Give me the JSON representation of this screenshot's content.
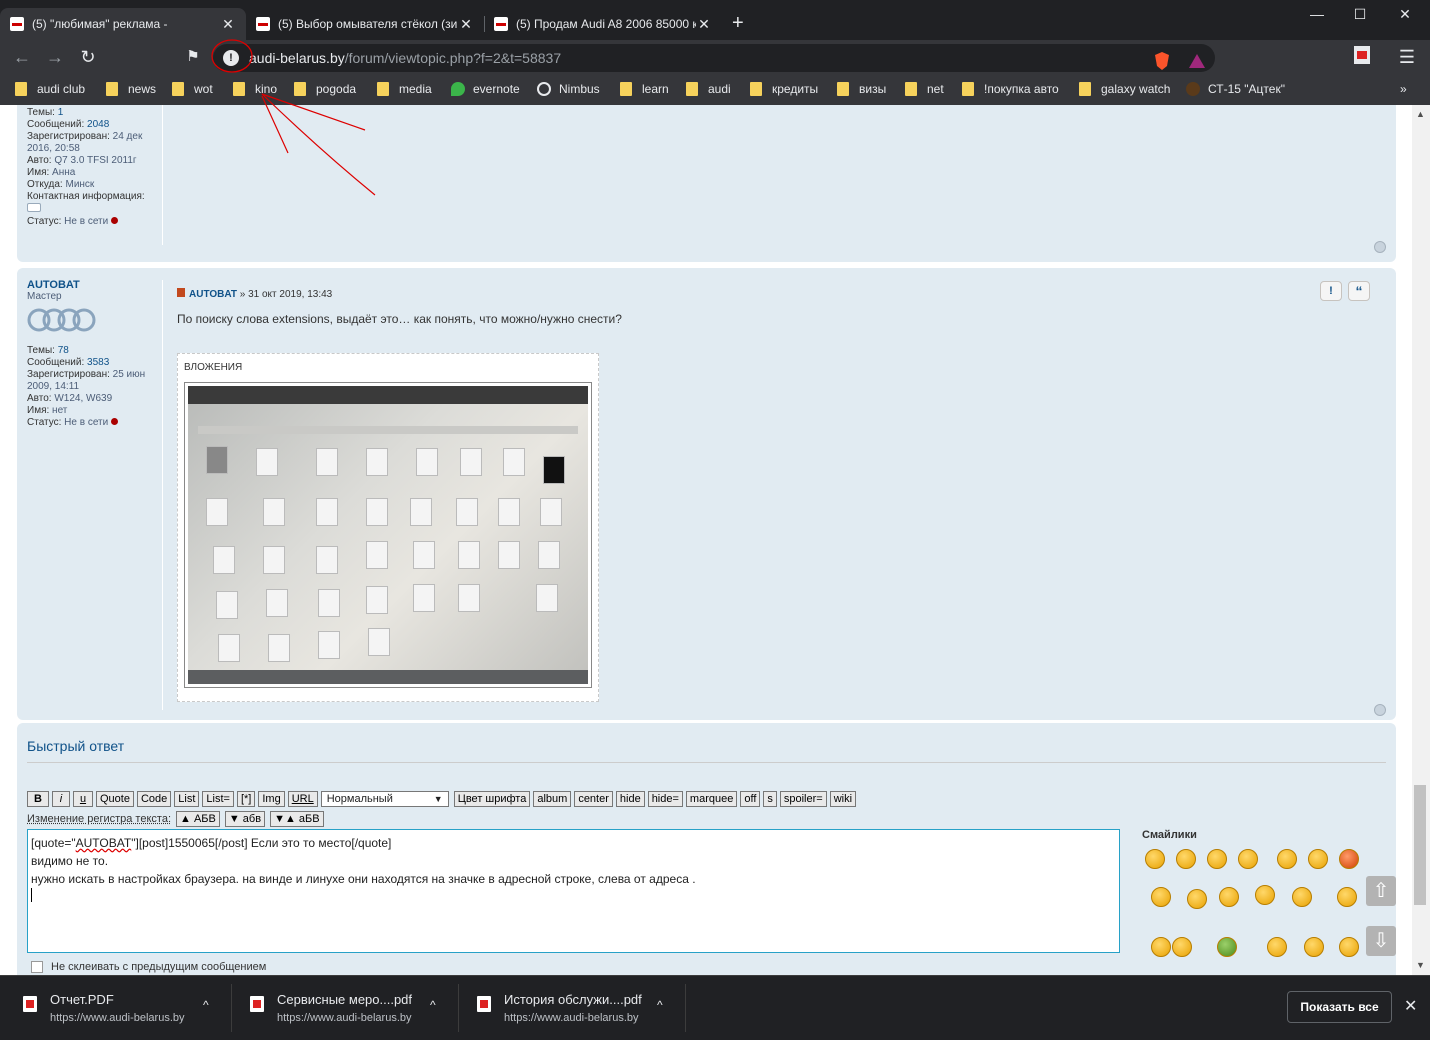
{
  "tabs": [
    {
      "title": "(5) \"любимая\" реклама -",
      "active": true
    },
    {
      "title": "(5) Выбор омывателя стёкол (зим",
      "active": false
    },
    {
      "title": "(5) Продам Audi A8 2006 85000 км",
      "active": false
    }
  ],
  "address": {
    "domain": "audi-belarus.by",
    "path": "/forum/viewtopic.php?f=2&t=58837"
  },
  "bookmarks": [
    {
      "label": "audi club",
      "icon": "folder-icon"
    },
    {
      "label": "news",
      "icon": "folder-icon"
    },
    {
      "label": "wot",
      "icon": "folder-icon"
    },
    {
      "label": "kino",
      "icon": "folder-icon"
    },
    {
      "label": "pogoda",
      "icon": "folder-icon"
    },
    {
      "label": "media",
      "icon": "folder-icon"
    },
    {
      "label": "evernote",
      "icon": "evernote-icon"
    },
    {
      "label": "Nimbus",
      "icon": "globe-icon"
    },
    {
      "label": "learn",
      "icon": "folder-icon"
    },
    {
      "label": "audi",
      "icon": "folder-icon"
    },
    {
      "label": "кредиты",
      "icon": "folder-icon"
    },
    {
      "label": "визы",
      "icon": "folder-icon"
    },
    {
      "label": "net",
      "icon": "folder-icon"
    },
    {
      "label": "!покупка авто",
      "icon": "folder-icon"
    },
    {
      "label": "galaxy watch",
      "icon": "folder-icon"
    },
    {
      "label": "СТ-15 \"Ацтек\"",
      "icon": "site-icon"
    }
  ],
  "post1": {
    "topics_label": "Темы:",
    "topics": "1",
    "messages_label": "Сообщений:",
    "messages": "2048",
    "registered_label": "Зарегистрирован:",
    "registered": "24 дек 2016, 20:58",
    "auto_label": "Авто:",
    "auto": "Q7 3.0 TFSI 2011г",
    "name_label": "Имя:",
    "name": "Анна",
    "from_label": "Откуда:",
    "from": "Минск",
    "contact_label": "Контактная информация:",
    "status_label": "Статус:",
    "status": "Не в сети"
  },
  "post2": {
    "author": "AUTOBAT",
    "rank": "Мастер",
    "topics_label": "Темы:",
    "topics": "78",
    "messages_label": "Сообщений:",
    "messages": "3583",
    "registered_label": "Зарегистрирован:",
    "registered": "25 июн 2009, 14:11",
    "auto_label": "Авто:",
    "auto": "W124, W639",
    "name_label": "Имя:",
    "name": "нет",
    "status_label": "Статус:",
    "status": "Не в сети",
    "header_author": "AUTOBAT",
    "header_date": " » 31 окт 2019, 13:43",
    "text": "По поиску слова extensions, выдаёт это… как понять, что можно/нужно снести?",
    "attachments_label": "ВЛОЖЕНИЯ",
    "report_btn": "!",
    "quote_btn": "“"
  },
  "quick_reply": {
    "title": "Быстрый ответ",
    "buttons": [
      "B",
      "i",
      "u",
      "Quote",
      "Code",
      "List",
      "List=",
      "[*]",
      "Img",
      "URL"
    ],
    "font_size": "Нормальный",
    "buttons2": [
      "Цвет шрифта",
      "album",
      "center",
      "hide",
      "hide=",
      "marquee",
      "off",
      "s",
      "spoiler=",
      "wiki"
    ],
    "case_label": "Изменение регистра текста:",
    "case_buttons": [
      "▲ АБВ",
      "▼ абв",
      "▼▲ аБВ"
    ],
    "line1_a": "[quote=\"",
    "line1_sp": "AUTOBAT",
    "line1_b": "\"][post]1550065[/post] Если это то место[/quote]",
    "line2": "видимо не то.",
    "line3": "нужно искать в настройках браузера. на винде и линухе они находятся на значке в адресной строке, слева от адреса .",
    "smilies_title": "Смайлики",
    "no_merge": "Не склеивать с предыдущим сообщением"
  },
  "downloads": [
    {
      "name": "Отчет.PDF",
      "src": "https://www.audi-belarus.by"
    },
    {
      "name": "Сервисные меро....pdf",
      "src": "https://www.audi-belarus.by"
    },
    {
      "name": "История обслужи....pdf",
      "src": "https://www.audi-belarus.by"
    }
  ],
  "show_all": "Показать все",
  "colors": {
    "accent": "#105289",
    "post_bg": "#e1ebf2",
    "chrome": "#202124"
  }
}
